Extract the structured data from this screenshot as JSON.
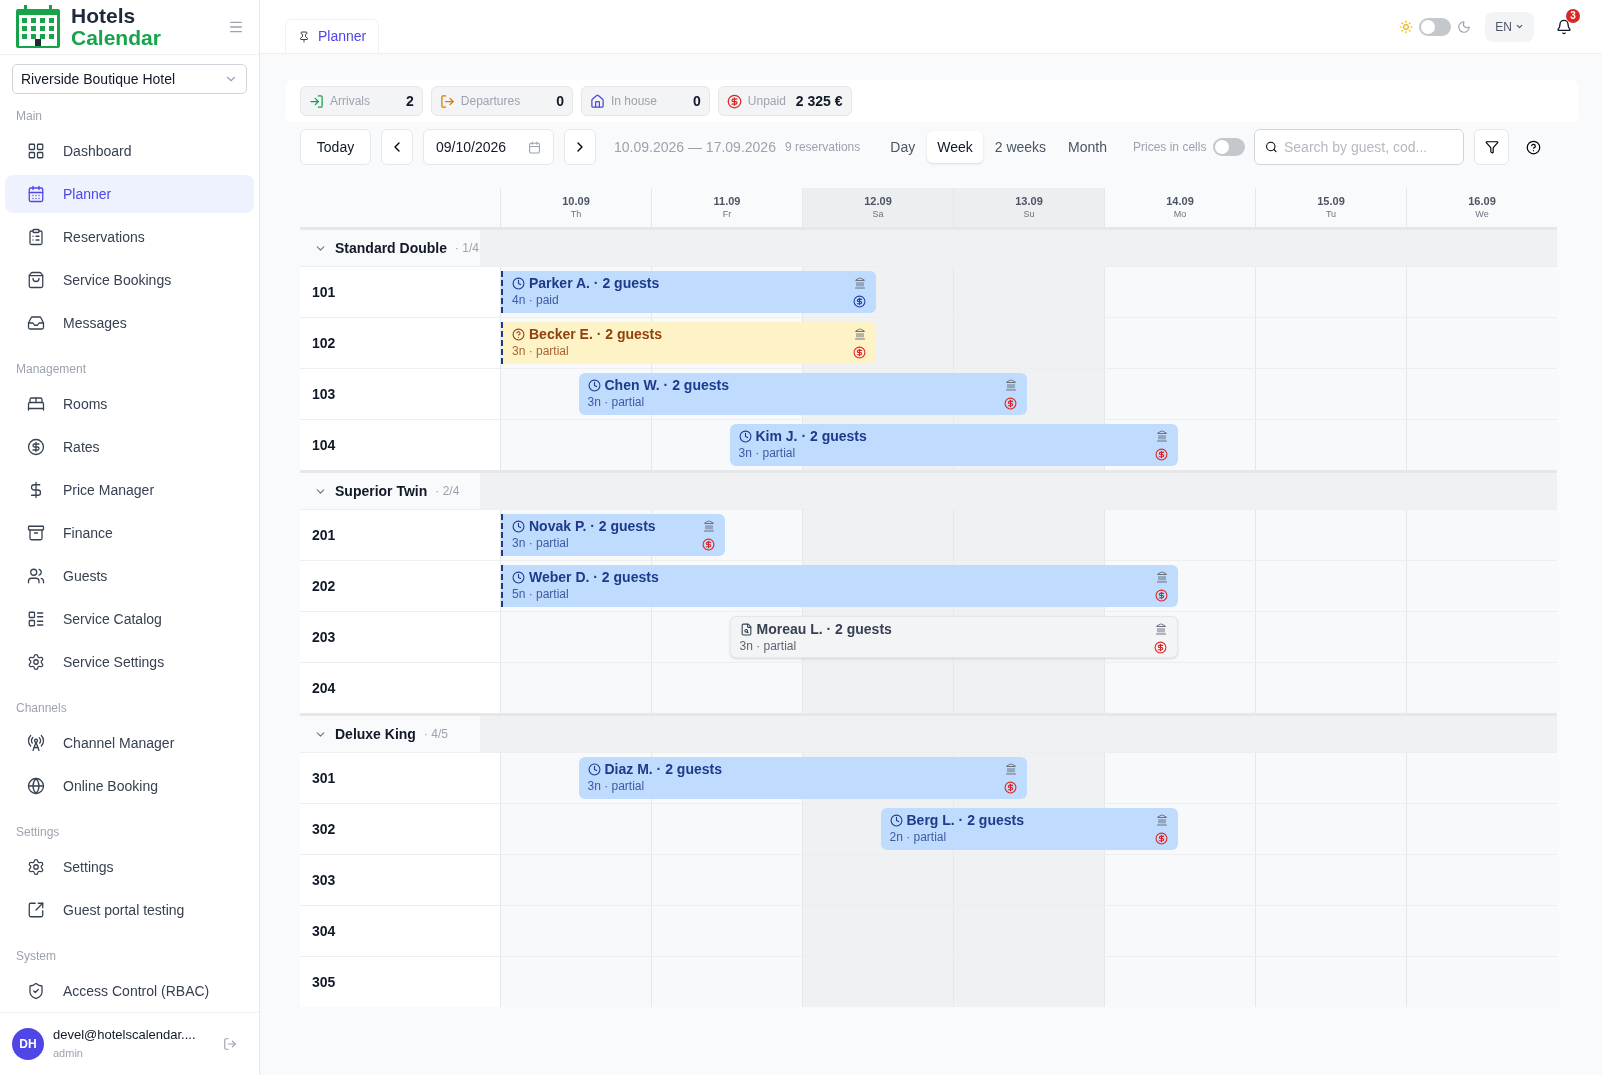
{
  "brand": {
    "line_1": "Hotels",
    "line_2": "Calendar"
  },
  "hotel_select": {
    "value": "Riverside Boutique Hotel"
  },
  "sidebar": {
    "sections": [
      {
        "title": "Main",
        "items": [
          {
            "label": "Dashboard",
            "selected": false
          },
          {
            "label": "Planner",
            "selected": true
          },
          {
            "label": "Reservations",
            "selected": false
          },
          {
            "label": "Service Bookings",
            "selected": false
          },
          {
            "label": "Messages",
            "selected": false
          }
        ]
      },
      {
        "title": "Management",
        "items": [
          {
            "label": "Rooms",
            "selected": false
          },
          {
            "label": "Rates",
            "selected": false
          },
          {
            "label": "Price Manager",
            "selected": false
          },
          {
            "label": "Finance",
            "selected": false
          },
          {
            "label": "Guests",
            "selected": false
          },
          {
            "label": "Service Catalog",
            "selected": false
          },
          {
            "label": "Service Settings",
            "selected": false
          }
        ]
      },
      {
        "title": "Channels",
        "items": [
          {
            "label": "Channel Manager",
            "selected": false
          },
          {
            "label": "Online Booking",
            "selected": false
          }
        ]
      },
      {
        "title": "Settings",
        "items": [
          {
            "label": "Settings",
            "selected": false
          },
          {
            "label": "Guest portal testing",
            "selected": false
          }
        ]
      },
      {
        "title": "System",
        "items": [
          {
            "label": "Access Control (RBAC)",
            "selected": false
          }
        ]
      }
    ]
  },
  "user": {
    "initials": "DH",
    "email": "devel@hotelscalendar....",
    "role": "admin"
  },
  "page_tab": {
    "label": "Planner",
    "selected": true
  },
  "header": {
    "dark_mode": false,
    "language": "EN",
    "notifications": "3"
  },
  "stats": [
    {
      "kind": "arrivals",
      "label": "Arrivals",
      "value": "2"
    },
    {
      "kind": "departures",
      "label": "Departures",
      "value": "0"
    },
    {
      "kind": "in_house",
      "label": "In house",
      "value": "0"
    },
    {
      "kind": "unpaid",
      "label": "Unpaid",
      "value": "2 325 €"
    }
  ],
  "toolbar": {
    "today": "Today",
    "date": "09/10/2026",
    "range": "10.09.2026 — 17.09.2026",
    "count": "9 reservations",
    "views": [
      {
        "label": "Day",
        "selected": false
      },
      {
        "label": "Week",
        "selected": true
      },
      {
        "label": "2 weeks",
        "selected": false
      },
      {
        "label": "Month",
        "selected": false
      }
    ],
    "prices_label": "Prices in cells",
    "prices_on": false,
    "search_placeholder": "Search by guest, cod..."
  },
  "days": [
    {
      "date": "10.09",
      "weekday": "Th",
      "weekend": false
    },
    {
      "date": "11.09",
      "weekday": "Fr",
      "weekend": false
    },
    {
      "date": "12.09",
      "weekday": "Sa",
      "weekend": true
    },
    {
      "date": "13.09",
      "weekday": "Su",
      "weekend": true
    },
    {
      "date": "14.09",
      "weekday": "Mo",
      "weekend": false
    },
    {
      "date": "15.09",
      "weekday": "Tu",
      "weekend": false
    },
    {
      "date": "16.09",
      "weekday": "We",
      "weekend": false
    }
  ],
  "groups": [
    {
      "name": "Standard Double",
      "count": "· 1/4",
      "expanded": true,
      "rooms": [
        {
          "number": "101",
          "bookings": [
            {
              "title": "Parker A. · 2 guests",
              "detail": "4n · paid",
              "kind": "confirmed",
              "paid": true,
              "continued": true
            }
          ]
        },
        {
          "number": "102",
          "bookings": [
            {
              "title": "Becker E. · 2 guests",
              "detail": "3n · partial",
              "kind": "pending",
              "paid": false,
              "continued": true
            }
          ]
        },
        {
          "number": "103",
          "bookings": [
            {
              "title": "Chen W. · 2 guests",
              "detail": "3n · partial",
              "kind": "confirmed",
              "paid": false,
              "continued": false
            }
          ]
        },
        {
          "number": "104",
          "bookings": [
            {
              "title": "Kim J. · 2 guests",
              "detail": "3n · partial",
              "kind": "confirmed",
              "paid": false,
              "continued": false
            }
          ]
        }
      ]
    },
    {
      "name": "Superior Twin",
      "count": "· 2/4",
      "expanded": true,
      "rooms": [
        {
          "number": "201",
          "bookings": [
            {
              "title": "Novak P. · 2 guests",
              "detail": "3n · partial",
              "kind": "confirmed",
              "paid": false,
              "continued": true
            }
          ]
        },
        {
          "number": "202",
          "bookings": [
            {
              "title": "Weber D. · 2 guests",
              "detail": "5n · partial",
              "kind": "confirmed",
              "paid": false,
              "continued": true
            }
          ]
        },
        {
          "number": "203",
          "bookings": [
            {
              "title": "Moreau L. · 2 guests",
              "detail": "3n · partial",
              "kind": "draft",
              "paid": false,
              "continued": false
            }
          ]
        },
        {
          "number": "204"
        }
      ]
    },
    {
      "name": "Deluxe King",
      "count": "· 4/5",
      "expanded": true,
      "rooms": [
        {
          "number": "301",
          "bookings": [
            {
              "title": "Diaz M. · 2 guests",
              "detail": "3n · partial",
              "kind": "confirmed",
              "paid": false,
              "continued": false
            }
          ]
        },
        {
          "number": "302",
          "bookings": [
            {
              "title": "Berg L. · 2 guests",
              "detail": "2n · partial",
              "kind": "confirmed",
              "paid": false,
              "continued": false
            }
          ]
        },
        {
          "number": "303"
        },
        {
          "number": "304"
        },
        {
          "number": "305"
        }
      ]
    }
  ]
}
